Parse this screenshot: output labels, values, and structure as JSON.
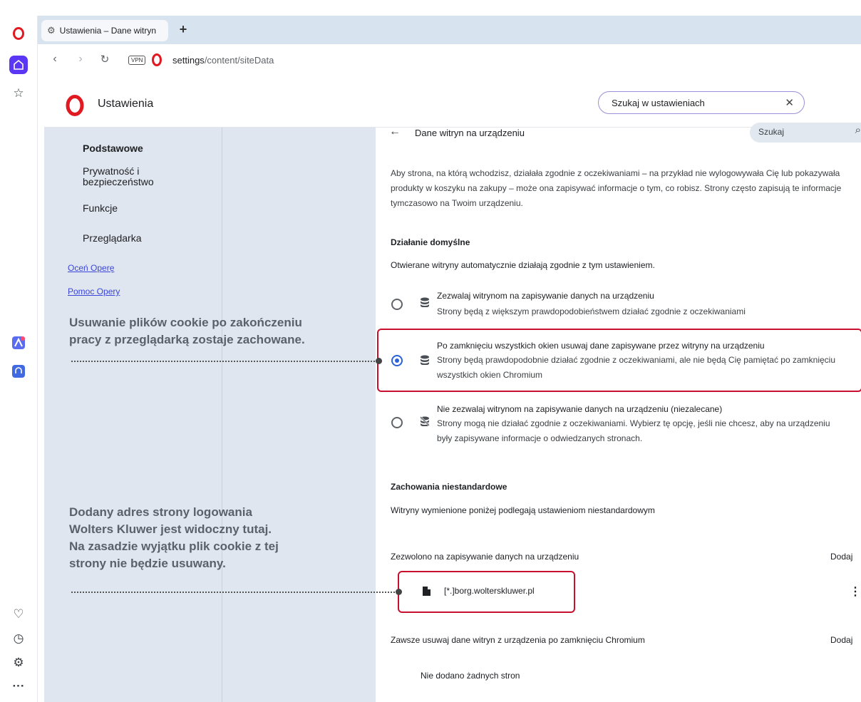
{
  "browser": {
    "tab_title": "Ustawienia – Dane witryn",
    "new_tab": "+",
    "vpn_badge": "VPN",
    "url_host": "settings",
    "url_path": "/content/siteData"
  },
  "sidebar": {
    "icons": [
      "opera-logo",
      "home",
      "star",
      "aria",
      "music",
      "heart",
      "history",
      "settings",
      "more"
    ],
    "accent": "#5b36f5"
  },
  "header": {
    "title": "Ustawienia",
    "search_value": "Szukaj w ustawieniach",
    "clear": "✕"
  },
  "nav": {
    "items": [
      "Podstawowe",
      "Prywatność i bezpieczeństwo",
      "Funkcje",
      "Przeglądarka"
    ],
    "links": [
      "Oceń Operę",
      "Pomoc Opery"
    ]
  },
  "content": {
    "back": "←",
    "title": "Dane witryn na urządzeniu",
    "search_placeholder": "Szukaj",
    "intro": "Aby strona, na którą wchodzisz, działała zgodnie z oczekiwaniami – na przykład nie wylogowywała Cię lub pokazywała produkty w koszyku na zakupy – może ona zapisywać informacje o tym, co robisz. Strony często zapisują te informacje tymczasowo na Twoim urządzeniu.",
    "default_heading": "Działanie domyślne",
    "default_desc": "Otwierane witryny automatycznie działają zgodnie z tym ustawieniem.",
    "options": [
      {
        "title": "Zezwalaj witrynom na zapisywanie danych na urządzeniu",
        "desc": "Strony będą z większym prawdopodobieństwem działać zgodnie z oczekiwaniami",
        "checked": false
      },
      {
        "title": "Po zamknięciu wszystkich okien usuwaj dane zapisywane przez witryny na urządzeniu",
        "desc": "Strony będą prawdopodobnie działać zgodnie z oczekiwaniami, ale nie będą Cię pamiętać po zamknięciu wszystkich okien Chromium",
        "checked": true
      },
      {
        "title": "Nie zezwalaj witrynom na zapisywanie danych na urządzeniu (niezalecane)",
        "desc": "Strony mogą nie działać zgodnie z oczekiwaniami. Wybierz tę opcję, jeśli nie chcesz, aby na urządzeniu były zapisywane informacje o odwiedzanych stronach.",
        "checked": false
      }
    ],
    "custom_heading": "Zachowania niestandardowe",
    "custom_desc": "Witryny wymienione poniżej podlegają ustawieniom niestandardowym",
    "allowed_label": "Zezwolono na zapisywanie danych na urządzeniu",
    "add_label": "Dodaj",
    "allowed_site": "[*.]borg.wolterskluwer.pl",
    "more_menu": "⋮",
    "clear_label": "Zawsze usuwaj dane witryn z urządzenia po zamknięciu Chromium",
    "add_label_2": "Dodaj",
    "no_sites": "Nie dodano żadnych stron"
  },
  "annotations": {
    "a1_line1": "Usuwanie plików cookie po zakończeniu",
    "a1_line2": "pracy z przeglądarką zostaje zachowane.",
    "a2_line1": "Dodany adres strony logowania",
    "a2_line2": "Wolters Kluwer jest widoczny tutaj.",
    "a2_line3": "Na zasadzie wyjątku plik cookie z tej",
    "a2_line4": "strony nie będzie usuwany.",
    "highlight_color": "#c8102e"
  }
}
